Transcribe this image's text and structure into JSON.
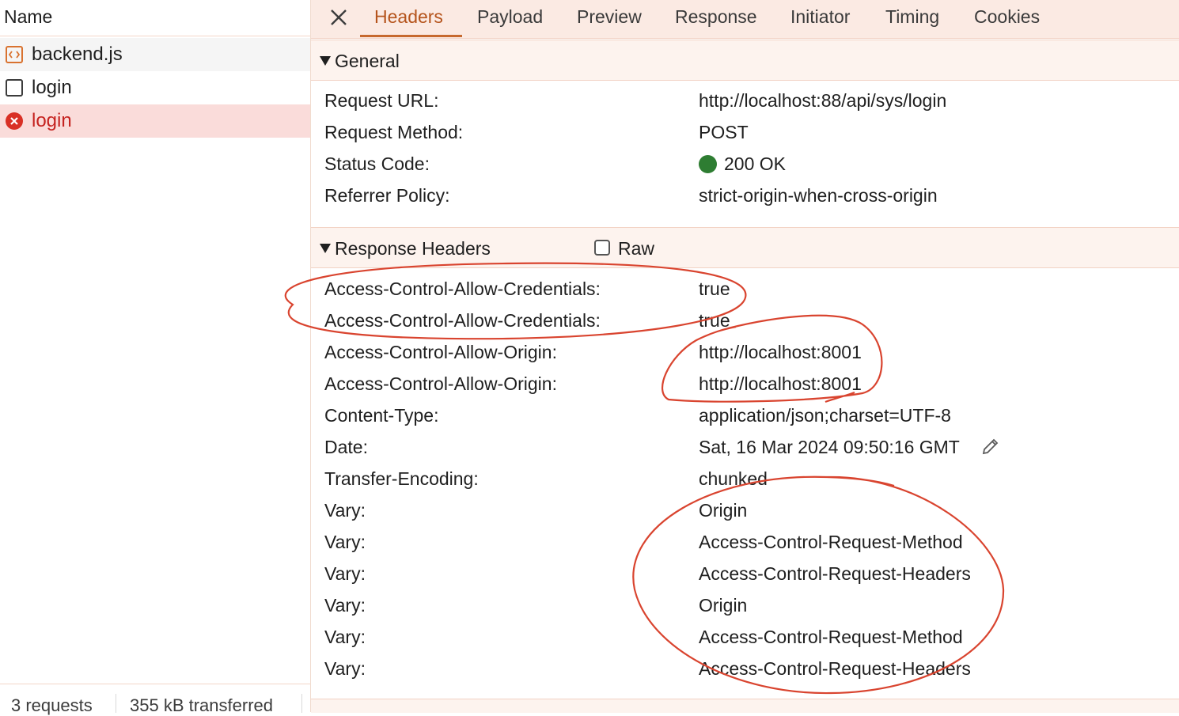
{
  "request_list": {
    "header": "Name",
    "items": [
      {
        "label": "backend.js",
        "icon": "script-file-icon"
      },
      {
        "label": "login",
        "icon": "checkbox-icon"
      },
      {
        "label": "login",
        "icon": "error-icon"
      }
    ],
    "footer": {
      "requests": "3 requests",
      "transferred": "355 kB transferred"
    }
  },
  "tabs": [
    "Headers",
    "Payload",
    "Preview",
    "Response",
    "Initiator",
    "Timing",
    "Cookies"
  ],
  "active_tab": "Headers",
  "general": {
    "title": "General",
    "rows": [
      {
        "key": "Request URL:",
        "value": "http://localhost:88/api/sys/login"
      },
      {
        "key": "Request Method:",
        "value": "POST"
      },
      {
        "key": "Status Code:",
        "value": "200 OK"
      },
      {
        "key": "Referrer Policy:",
        "value": "strict-origin-when-cross-origin"
      }
    ]
  },
  "response_headers": {
    "title": "Response Headers",
    "raw_label": "Raw",
    "rows": [
      {
        "key": "Access-Control-Allow-Credentials:",
        "value": "true"
      },
      {
        "key": "Access-Control-Allow-Credentials:",
        "value": "true"
      },
      {
        "key": "Access-Control-Allow-Origin:",
        "value": "http://localhost:8001"
      },
      {
        "key": "Access-Control-Allow-Origin:",
        "value": "http://localhost:8001"
      },
      {
        "key": "Content-Type:",
        "value": "application/json;charset=UTF-8"
      },
      {
        "key": "Date:",
        "value": "Sat, 16 Mar 2024 09:50:16 GMT"
      },
      {
        "key": "Transfer-Encoding:",
        "value": "chunked"
      },
      {
        "key": "Vary:",
        "value": "Origin"
      },
      {
        "key": "Vary:",
        "value": "Access-Control-Request-Method"
      },
      {
        "key": "Vary:",
        "value": "Access-Control-Request-Headers"
      },
      {
        "key": "Vary:",
        "value": "Origin"
      },
      {
        "key": "Vary:",
        "value": "Access-Control-Request-Method"
      },
      {
        "key": "Vary:",
        "value": "Access-Control-Request-Headers"
      }
    ]
  },
  "colors": {
    "accent": "#b5541c",
    "error": "#c5221f",
    "status_ok": "#2e7d32",
    "annotation": "#d9442f"
  }
}
